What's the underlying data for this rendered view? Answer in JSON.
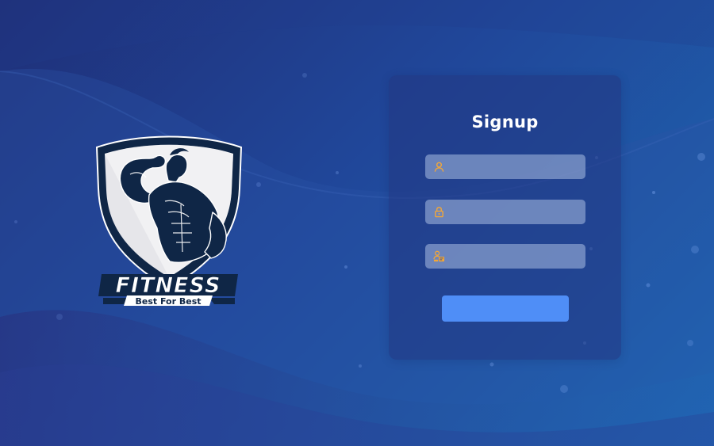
{
  "logo": {
    "brand": "FITNESS",
    "tagline": "Best For Best"
  },
  "signup": {
    "title": "Signup",
    "fields": [
      {
        "icon": "user-icon",
        "value": "",
        "placeholder": ""
      },
      {
        "icon": "lock-icon",
        "value": "",
        "placeholder": ""
      },
      {
        "icon": "id-card-icon",
        "value": "",
        "placeholder": ""
      }
    ],
    "submit_label": ""
  },
  "colors": {
    "background": "#20479a",
    "card": "#223682",
    "field": "#aabee1",
    "icon": "#f0a63a",
    "button": "#4f8ef7",
    "text": "#ffffff"
  }
}
